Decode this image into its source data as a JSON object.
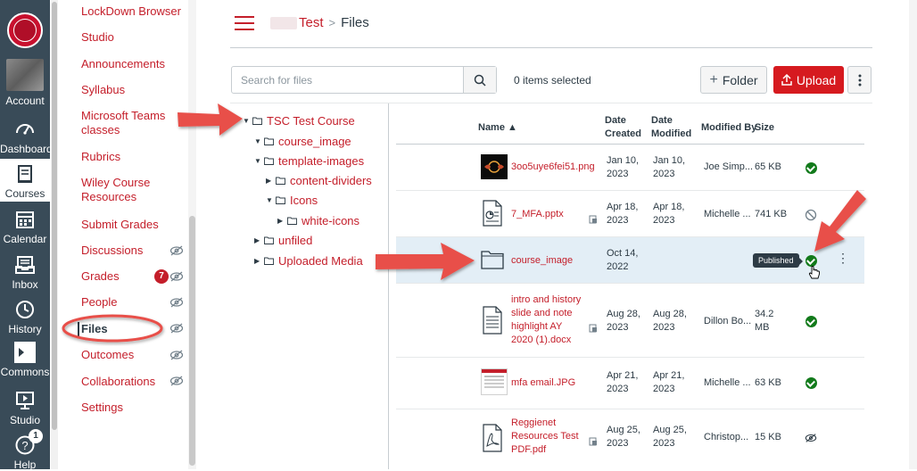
{
  "global_nav": {
    "items": [
      {
        "label": "Account",
        "icon": "avatar"
      },
      {
        "label": "Dashboard",
        "icon": "dashboard-icon"
      },
      {
        "label": "Courses",
        "icon": "courses-icon",
        "active": true
      },
      {
        "label": "Calendar",
        "icon": "calendar-icon"
      },
      {
        "label": "Inbox",
        "icon": "inbox-icon"
      },
      {
        "label": "History",
        "icon": "history-icon"
      },
      {
        "label": "Commons",
        "icon": "commons-icon"
      },
      {
        "label": "Studio",
        "icon": "studio-icon"
      },
      {
        "label": "Help",
        "icon": "help-icon",
        "badge": "1"
      }
    ]
  },
  "course_nav": {
    "items": [
      {
        "label": "LockDown Browser"
      },
      {
        "label": "Studio"
      },
      {
        "label": "Announcements"
      },
      {
        "label": "Syllabus"
      },
      {
        "label": "Microsoft Teams classes"
      },
      {
        "label": "Rubrics"
      },
      {
        "label": "Wiley Course Resources"
      },
      {
        "label": "Submit Grades"
      },
      {
        "label": "Discussions",
        "hidden": true
      },
      {
        "label": "Grades",
        "badge": "7",
        "hidden": true
      },
      {
        "label": "People",
        "hidden": true
      },
      {
        "label": "Files",
        "active": true,
        "hidden": true
      },
      {
        "label": "Outcomes",
        "hidden": true
      },
      {
        "label": "Collaborations",
        "hidden": true
      },
      {
        "label": "Settings"
      }
    ]
  },
  "breadcrumb": {
    "course": "Test",
    "separator": ">",
    "current": "Files"
  },
  "toolbar": {
    "search_placeholder": "Search for files",
    "items_selected": "0 items selected",
    "folder_label": "Folder",
    "folder_prefix": "+",
    "upload_label": "Upload"
  },
  "tree": [
    {
      "label": "TSC Test Course",
      "expanded": true
    },
    {
      "label": "course_image",
      "expanded": true
    },
    {
      "label": "template-images",
      "expanded": true
    },
    {
      "label": "content-dividers",
      "expanded": false
    },
    {
      "label": "Icons",
      "expanded": true
    },
    {
      "label": "white-icons",
      "expanded": false
    },
    {
      "label": "unfiled",
      "expanded": false
    },
    {
      "label": "Uploaded Media",
      "expanded": false
    }
  ],
  "table": {
    "headers": {
      "name": "Name ▲",
      "created": "Date Created",
      "modified": "Date Modified",
      "modified_by": "Modified By",
      "size": "Size"
    },
    "rows": [
      {
        "name": "3oo5uye6fei51.png",
        "created": "Jan 10, 2023",
        "modified": "Jan 10, 2023",
        "modified_by": "Joe Simp...",
        "size": "65 KB",
        "status": "published",
        "type": "image"
      },
      {
        "name": "7_MFA.pptx",
        "created": "Apr 18, 2023",
        "modified": "Apr 18, 2023",
        "modified_by": "Michelle ...",
        "size": "741 KB",
        "status": "unpublished",
        "type": "pptx"
      },
      {
        "name": "course_image",
        "created": "Oct 14, 2022",
        "modified": "",
        "modified_by": "",
        "size": "",
        "status": "published",
        "type": "folder"
      },
      {
        "name": "intro and history slide and note highlight AY 2020 (1).docx",
        "created": "Aug 28, 2023",
        "modified": "Aug 28, 2023",
        "modified_by": "Dillon Bo...",
        "size": "34.2 MB",
        "status": "published",
        "type": "docx"
      },
      {
        "name": "mfa email.JPG",
        "created": "Apr 21, 2023",
        "modified": "Apr 21, 2023",
        "modified_by": "Michelle ...",
        "size": "63 KB",
        "status": "published",
        "type": "image2"
      },
      {
        "name": "Reggienet Resources Test PDF.pdf",
        "created": "Aug 25, 2023",
        "modified": "Aug 25, 2023",
        "modified_by": "Christop...",
        "size": "15 KB",
        "status": "hidden",
        "type": "pdf"
      }
    ],
    "tooltip": "Published"
  },
  "colors": {
    "brand": "#c41e2a",
    "nav_bg": "#394b58",
    "upload_bg": "#d61a1f",
    "published": "#127a1b",
    "selected_row": "#e3eef6",
    "annotation": "#e8504a"
  }
}
